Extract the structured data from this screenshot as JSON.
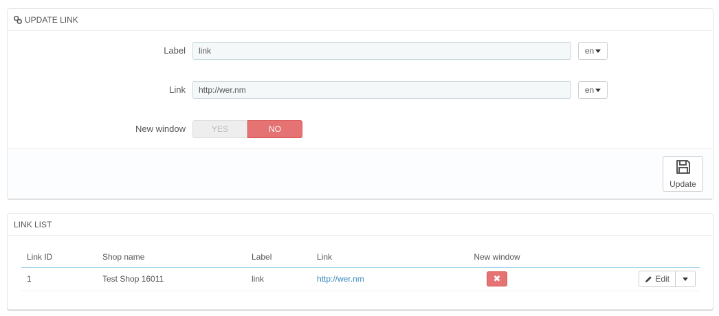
{
  "update_panel": {
    "title": "UPDATE LINK",
    "label_field": {
      "label": "Label",
      "value": "link",
      "lang": "en"
    },
    "link_field": {
      "label": "Link",
      "value": "http://wer.nm",
      "lang": "en"
    },
    "new_window": {
      "label": "New window",
      "yes": "YES",
      "no": "NO",
      "selected": "NO"
    },
    "update_button": "Update"
  },
  "list_panel": {
    "title": "LINK LIST",
    "columns": [
      "Link ID",
      "Shop name",
      "Label",
      "Link",
      "New window",
      ""
    ],
    "rows": [
      {
        "id": "1",
        "shop": "Test Shop 16011",
        "label": "link",
        "link": "http://wer.nm",
        "new_window": "✖",
        "action": "Edit"
      }
    ]
  },
  "colors": {
    "accent": "#25b9d7",
    "danger": "#e57373",
    "header_border": "#a0d0eb"
  }
}
